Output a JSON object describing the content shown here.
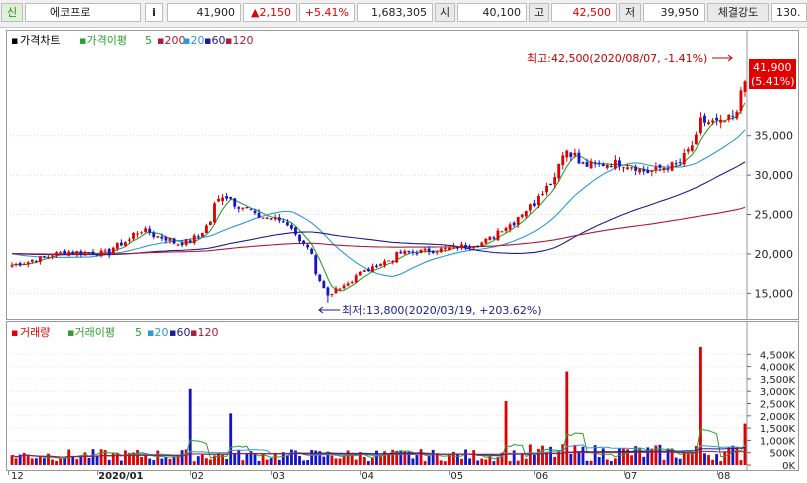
{
  "header": {
    "market_badge": "신",
    "stock_name": "에코프로",
    "info_button": "i",
    "current_price": "41,900",
    "change": "▲2,150",
    "change_pct": "+5.41%",
    "volume": "1,683,305",
    "open_label": "시",
    "open_value": "40,100",
    "high_label": "고",
    "high_value": "42,500",
    "low_label": "저",
    "low_value": "39,950",
    "strength_label": "체결강도",
    "strength_value": "130."
  },
  "colors": {
    "up": "#e00000",
    "down": "#1414c8",
    "ma5": "#2e9e2e",
    "ma20": "#2a9ad8",
    "ma60": "#1c1c8e",
    "ma120": "#a81c3c"
  },
  "price_legend": {
    "marker": "▪",
    "title": "가격차트",
    "ma_title": "가격이평",
    "p5": "5",
    "p20": "20",
    "p60": "60",
    "p120": "120"
  },
  "volume_legend": {
    "marker": "▪",
    "title": "거래량",
    "ma_title": "거래이평",
    "p5": "5",
    "p20": "20",
    "p60": "60",
    "p120": "120"
  },
  "annotations": {
    "high": "최고:42,500(2020/08/07, -1.41%)",
    "low": "최저:13,800(2020/03/19, +203.62%)",
    "last_price": "41,900",
    "last_pct": "(5.41%)"
  },
  "chart_data": [
    {
      "type": "candlestick",
      "title": "가격차트",
      "ylim": [
        12000,
        46000
      ],
      "yticks": [
        "15,000",
        "20,000",
        "25,000",
        "30,000",
        "35,000"
      ],
      "ytick_values": [
        15000,
        20000,
        25000,
        30000,
        35000
      ],
      "series_names": [
        "가격이평 5",
        "20",
        "60",
        "120"
      ],
      "keypoints": [
        {
          "date": "2019-12-02",
          "close": 18600
        },
        {
          "date": "2019-12-20",
          "close": 20300
        },
        {
          "date": "2020-01-03",
          "close": 20100
        },
        {
          "date": "2020-01-15",
          "close": 23000
        },
        {
          "date": "2020-01-28",
          "close": 21300
        },
        {
          "date": "2020-02-04",
          "close": 22200
        },
        {
          "date": "2020-02-12",
          "close": 27500
        },
        {
          "date": "2020-02-24",
          "close": 24800
        },
        {
          "date": "2020-03-04",
          "close": 24200
        },
        {
          "date": "2020-03-11",
          "close": 21500
        },
        {
          "date": "2020-03-19",
          "close": 14600
        },
        {
          "date": "2020-03-31",
          "close": 17600
        },
        {
          "date": "2020-04-14",
          "close": 20100
        },
        {
          "date": "2020-04-29",
          "close": 20600
        },
        {
          "date": "2020-05-12",
          "close": 21400
        },
        {
          "date": "2020-05-25",
          "close": 24800
        },
        {
          "date": "2020-06-03",
          "close": 28500
        },
        {
          "date": "2020-06-10",
          "close": 33200
        },
        {
          "date": "2020-06-16",
          "close": 31200
        },
        {
          "date": "2020-06-29",
          "close": 31600
        },
        {
          "date": "2020-07-08",
          "close": 30400
        },
        {
          "date": "2020-07-20",
          "close": 31600
        },
        {
          "date": "2020-07-27",
          "close": 36800
        },
        {
          "date": "2020-08-03",
          "close": 36500
        },
        {
          "date": "2020-08-07",
          "close": 37600
        },
        {
          "date": "2020-08-11",
          "close": 41900
        }
      ],
      "high": 42500,
      "low": 13800,
      "last": 41900
    },
    {
      "type": "bar",
      "title": "거래량",
      "ylim": [
        0,
        5000000
      ],
      "yticks": [
        "4,500K",
        "4,000K",
        "3,500K",
        "3,000K",
        "2,500K",
        "2,000K",
        "1,500K",
        "1,000K",
        "500K",
        "0K"
      ],
      "ytick_values": [
        4500000,
        4000000,
        3500000,
        3000000,
        2500000,
        2000000,
        1500000,
        1000000,
        500000,
        0
      ],
      "series_names": [
        "거래이평 5",
        "20",
        "60",
        "120"
      ],
      "spikes": [
        {
          "date": "2020-01-31",
          "volume": 3100000
        },
        {
          "date": "2020-02-14",
          "volume": 2100000
        },
        {
          "date": "2020-05-20",
          "volume": 2600000
        },
        {
          "date": "2020-06-10",
          "volume": 3800000
        },
        {
          "date": "2020-07-27",
          "volume": 4800000
        },
        {
          "date": "2020-08-11",
          "volume": 1683305
        }
      ],
      "x_labels": [
        "12",
        "2020/01",
        "02",
        "03",
        "04",
        "05",
        "06",
        "07",
        "08"
      ]
    }
  ]
}
